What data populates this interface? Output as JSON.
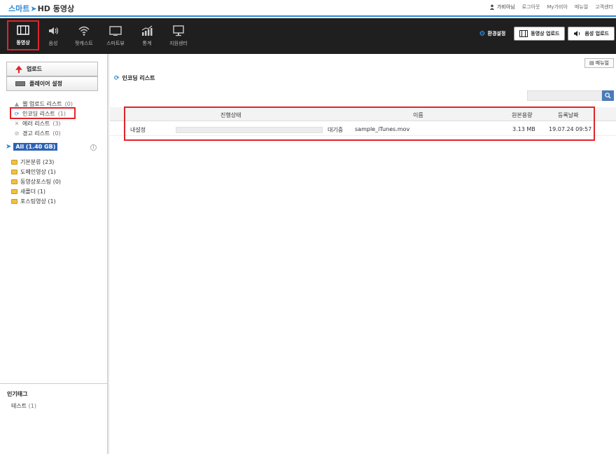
{
  "app": {
    "logo_smart": "스마트",
    "logo_rest": "HD 동영상"
  },
  "topnav": {
    "user": "가비아님",
    "logout": "로그아웃",
    "mygabia": "My가비아",
    "manual": "매뉴얼",
    "support": "고객센터"
  },
  "toolbar": {
    "items": [
      {
        "label": "동영상",
        "icon": "film-icon"
      },
      {
        "label": "음성",
        "icon": "speaker-icon"
      },
      {
        "label": "팟캐스트",
        "icon": "wifi-icon"
      },
      {
        "label": "스마트뷰",
        "icon": "monitor-icon"
      },
      {
        "label": "통계",
        "icon": "chart-icon"
      },
      {
        "label": "지원센터",
        "icon": "desktop-icon"
      }
    ],
    "env_settings": "환경설정",
    "upload_video": "동영상 업로드",
    "upload_audio": "음성 업로드"
  },
  "sidebar": {
    "upload_btn": "업로드",
    "player_btn": "플레이어 설정",
    "lists": [
      {
        "label": "웹 업로드 리스트",
        "count": "(0)",
        "icon": "up-arrow-icon"
      },
      {
        "label": "인코딩 리스트",
        "count": "(1)",
        "icon": "encoding-icon"
      },
      {
        "label": "에러 리스트",
        "count": "(3)",
        "icon": "x-icon"
      },
      {
        "label": "경고 리스트",
        "count": "(0)",
        "icon": "warning-icon"
      }
    ],
    "all_label": "All (1.40 GB)",
    "info": "i",
    "folders": [
      {
        "label": "기본분류 (23)"
      },
      {
        "label": "도메인영상 (1)"
      },
      {
        "label": "동영상포스팅 (0)"
      },
      {
        "label": "새폴더 (1)"
      },
      {
        "label": "포스팅영상 (1)"
      }
    ],
    "tags_title": "인기태그",
    "tag": {
      "label": "테스트",
      "count": "(1)"
    }
  },
  "main": {
    "manual_btn": "매뉴얼",
    "title": "인코딩 리스트",
    "search_value": "",
    "table": {
      "headers": {
        "progress": "진행상태",
        "name": "이름",
        "size": "원본용량",
        "date": "등록날짜"
      },
      "rows": [
        {
          "setting": "내설정",
          "progress": 0,
          "status": "대기중",
          "name": "sample_iTunes.mov",
          "size": "3.13 MB",
          "date": "19.07.24 09:57"
        }
      ]
    }
  },
  "colors": {
    "accent": "#2b89d6",
    "highlight": "#e0242b",
    "toolbar_bg": "#1f1f1f"
  }
}
